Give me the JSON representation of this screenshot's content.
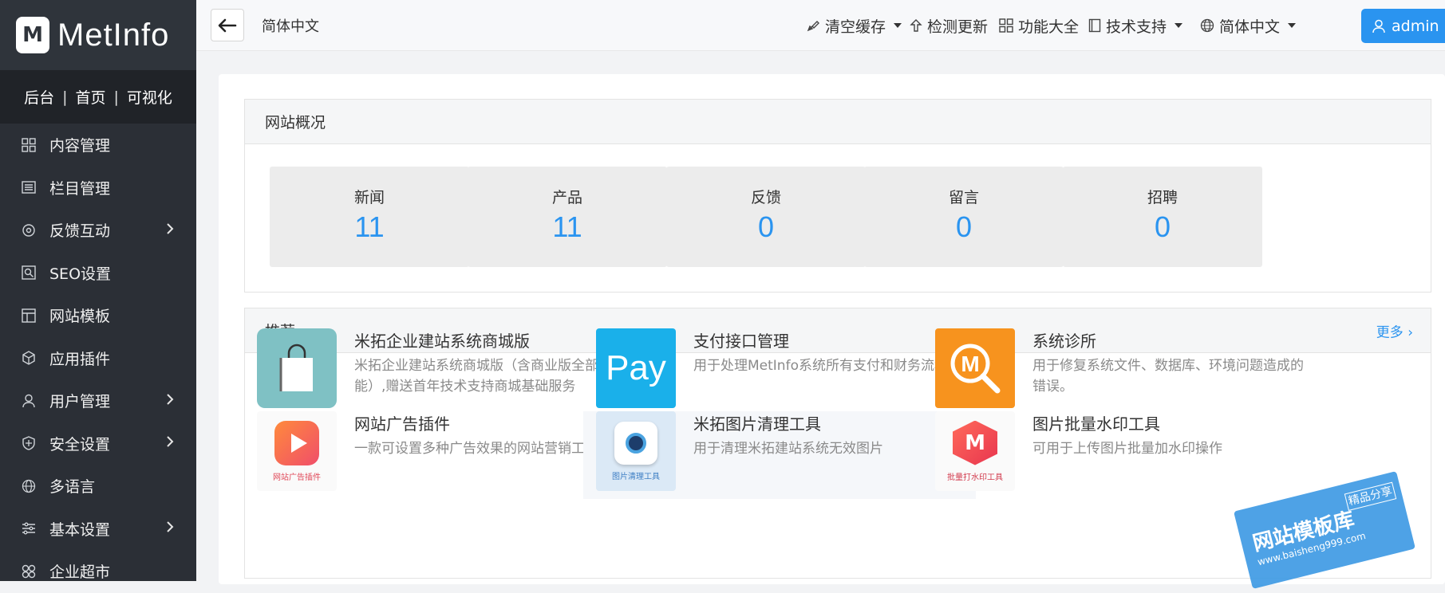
{
  "app": {
    "logo_text": "MetInfo",
    "logo_mark": "M"
  },
  "quick_links": [
    "后台",
    "首页",
    "可视化"
  ],
  "sidebar": {
    "items": [
      {
        "label": "内容管理",
        "icon": "grid-icon",
        "has_submenu": false
      },
      {
        "label": "栏目管理",
        "icon": "list-icon",
        "has_submenu": false
      },
      {
        "label": "反馈互动",
        "icon": "feedback-icon",
        "has_submenu": true
      },
      {
        "label": "SEO设置",
        "icon": "seo-icon",
        "has_submenu": false
      },
      {
        "label": "网站模板",
        "icon": "template-icon",
        "has_submenu": false
      },
      {
        "label": "应用插件",
        "icon": "plugin-box-icon",
        "has_submenu": false
      },
      {
        "label": "用户管理",
        "icon": "user-icon",
        "has_submenu": true
      },
      {
        "label": "安全设置",
        "icon": "shield-icon",
        "has_submenu": true
      },
      {
        "label": "多语言",
        "icon": "globe-icon",
        "has_submenu": false
      },
      {
        "label": "基本设置",
        "icon": "sliders-icon",
        "has_submenu": true
      },
      {
        "label": "企业超市",
        "icon": "store-icon",
        "has_submenu": false
      }
    ]
  },
  "topbar": {
    "current_language": "简体中文",
    "clear_cache": "清空缓存",
    "check_update": "检测更新",
    "all_functions": "功能大全",
    "tech_support": "技术支持",
    "language_menu": "简体中文",
    "user": "admin"
  },
  "overview": {
    "title": "网站概况",
    "stats": [
      {
        "label": "新闻",
        "value": "11"
      },
      {
        "label": "产品",
        "value": "11"
      },
      {
        "label": "反馈",
        "value": "0"
      },
      {
        "label": "留言",
        "value": "0"
      },
      {
        "label": "招聘",
        "value": "0"
      }
    ]
  },
  "recommend": {
    "title": "推荐",
    "more": "更多",
    "items": [
      {
        "title": "米拓企业建站系统商城版",
        "desc": "米拓企业建站系统商城版（含商业版全部功能）,赠送首年技术支持商城基础服务",
        "icon": "shopping-bag-icon",
        "color": "#7fc1c4"
      },
      {
        "title": "支付接口管理",
        "desc": "用于处理MetInfo系统所有支付和财务流程",
        "icon": "pay-icon",
        "icon_text": "Pay",
        "color": "#1ab0ea"
      },
      {
        "title": "系统诊所",
        "desc": "用于修复系统文件、数据库、环境问题造成的错误。",
        "icon": "magnifier-m-icon",
        "icon_text": "M",
        "color": "#f7931e"
      },
      {
        "title": "网站广告插件",
        "desc": "一款可设置多种广告效果的网站营销工具",
        "icon": "ad-play-icon",
        "icon_text": "网站广告插件",
        "color": "#f04e6a"
      },
      {
        "title": "米拓图片清理工具",
        "desc": "用于清理米拓建站系统无效图片",
        "icon": "camera-icon",
        "icon_text": "图片清理工具",
        "color": "#4aa3e0"
      },
      {
        "title": "图片批量水印工具",
        "desc": "可用于上传图片批量加水印操作",
        "icon": "watermark-m-icon",
        "icon_text": "批量打水印工具",
        "color": "#e8354f"
      }
    ]
  },
  "watermark": {
    "text": "网站模板库",
    "url": "www.baisheng999.com",
    "badge": "精品分享"
  }
}
